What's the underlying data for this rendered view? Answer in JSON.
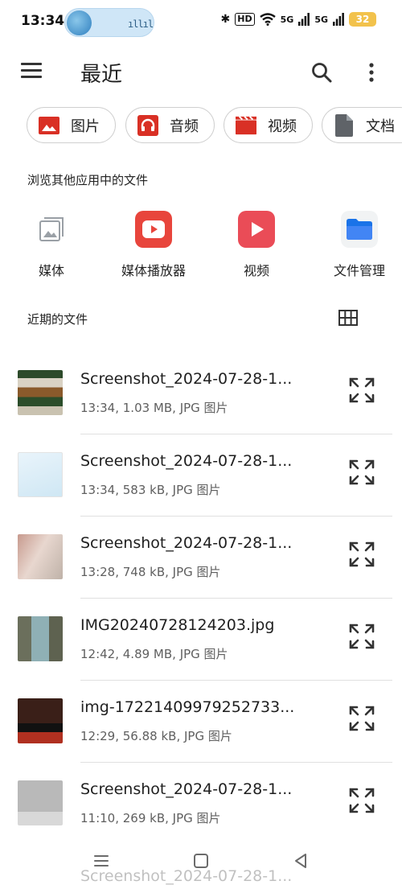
{
  "status_bar": {
    "time": "13:34",
    "signal_label_1": "5G",
    "signal_label_2": "5G",
    "hd_label": "HD",
    "battery_level": "32"
  },
  "app_bar": {
    "title": "最近"
  },
  "chips": [
    {
      "label": "图片",
      "icon": "image-icon",
      "color": "#d93025"
    },
    {
      "label": "音频",
      "icon": "headphones-icon",
      "color": "#d93025"
    },
    {
      "label": "视频",
      "icon": "video-icon",
      "color": "#d93025"
    },
    {
      "label": "文档",
      "icon": "document-icon",
      "color": "#5f6368"
    }
  ],
  "browse_section": {
    "heading": "浏览其他应用中的文件",
    "apps": [
      {
        "label": "媒体",
        "icon": "media-gallery-icon"
      },
      {
        "label": "媒体播放器",
        "icon": "media-player-icon",
        "color": "#e8453c"
      },
      {
        "label": "视频",
        "icon": "video-play-icon",
        "color": "#e8453c"
      },
      {
        "label": "文件管理",
        "icon": "folder-icon",
        "color": "#1a73e8"
      }
    ]
  },
  "recent_section": {
    "heading": "近期的文件"
  },
  "files": [
    {
      "name": "Screenshot_2024-07-28-1...",
      "meta": "13:34, 1.03 MB, JPG 图片"
    },
    {
      "name": "Screenshot_2024-07-28-1...",
      "meta": "13:34, 583 kB, JPG 图片"
    },
    {
      "name": "Screenshot_2024-07-28-1...",
      "meta": "13:28, 748 kB, JPG 图片"
    },
    {
      "name": "IMG20240728124203.jpg",
      "meta": "12:42, 4.89 MB, JPG 图片"
    },
    {
      "name": "img-17221409979252733...",
      "meta": "12:29, 56.88 kB, JPG 图片"
    },
    {
      "name": "Screenshot_2024-07-28-1...",
      "meta": "11:10, 269 kB, JPG 图片"
    },
    {
      "name": "Screenshot_2024-07-28-1...",
      "meta": ""
    }
  ],
  "colors": {
    "accent_red": "#d93025",
    "chip_border": "#cfcfcf",
    "folder_blue": "#1a73e8"
  }
}
